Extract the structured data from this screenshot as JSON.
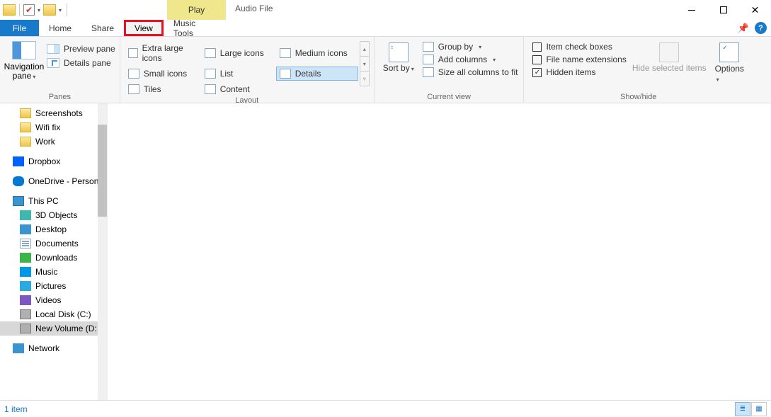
{
  "title": "Audio File",
  "contextual_tab": "Play",
  "tabs": {
    "file": "File",
    "home": "Home",
    "share": "Share",
    "view": "View",
    "music": "Music Tools"
  },
  "ribbon": {
    "panes": {
      "nav": "Navigation pane",
      "preview": "Preview pane",
      "details": "Details pane",
      "label": "Panes"
    },
    "layout": {
      "xl": "Extra large icons",
      "lg": "Large icons",
      "md": "Medium icons",
      "sm": "Small icons",
      "list": "List",
      "details": "Details",
      "tiles": "Tiles",
      "content": "Content",
      "label": "Layout"
    },
    "currentview": {
      "sort": "Sort by",
      "group": "Group by",
      "addcols": "Add columns",
      "sizecols": "Size all columns to fit",
      "label": "Current view"
    },
    "showhide": {
      "itemcheck": "Item check boxes",
      "fne": "File name extensions",
      "hidden": "Hidden items",
      "hidesel": "Hide selected items",
      "options": "Options",
      "label": "Show/hide"
    }
  },
  "sidebar": [
    {
      "key": "screenshots",
      "label": "Screenshots",
      "class": "folder",
      "indent": "tree-item"
    },
    {
      "key": "wifi",
      "label": "Wifi fix",
      "class": "folder",
      "indent": "tree-item"
    },
    {
      "key": "work",
      "label": "Work",
      "class": "folder",
      "indent": "tree-item"
    },
    {
      "key": "spacer1",
      "label": "",
      "class": "",
      "indent": "spacer"
    },
    {
      "key": "dropbox",
      "label": "Dropbox",
      "class": "dropbox",
      "indent": "tree-item root"
    },
    {
      "key": "spacer2",
      "label": "",
      "class": "",
      "indent": "spacer"
    },
    {
      "key": "onedrive",
      "label": "OneDrive - Person",
      "class": "onedrive",
      "indent": "tree-item root"
    },
    {
      "key": "spacer3",
      "label": "",
      "class": "",
      "indent": "spacer"
    },
    {
      "key": "thispc",
      "label": "This PC",
      "class": "thispc",
      "indent": "tree-item root"
    },
    {
      "key": "3d",
      "label": "3D Objects",
      "class": "obj3d",
      "indent": "tree-item"
    },
    {
      "key": "desktop",
      "label": "Desktop",
      "class": "desktop",
      "indent": "tree-item"
    },
    {
      "key": "documents",
      "label": "Documents",
      "class": "doc",
      "indent": "tree-item"
    },
    {
      "key": "downloads",
      "label": "Downloads",
      "class": "down",
      "indent": "tree-item"
    },
    {
      "key": "music",
      "label": "Music",
      "class": "music",
      "indent": "tree-item"
    },
    {
      "key": "pictures",
      "label": "Pictures",
      "class": "pic",
      "indent": "tree-item"
    },
    {
      "key": "videos",
      "label": "Videos",
      "class": "vid",
      "indent": "tree-item"
    },
    {
      "key": "cdrive",
      "label": "Local Disk (C:)",
      "class": "disk",
      "indent": "tree-item"
    },
    {
      "key": "ddrive",
      "label": "New Volume (D:",
      "class": "disk",
      "indent": "tree-item sel"
    },
    {
      "key": "spacer4",
      "label": "",
      "class": "",
      "indent": "spacer"
    },
    {
      "key": "network",
      "label": "Network",
      "class": "net",
      "indent": "tree-item root"
    }
  ],
  "status": {
    "left": "1 item"
  }
}
